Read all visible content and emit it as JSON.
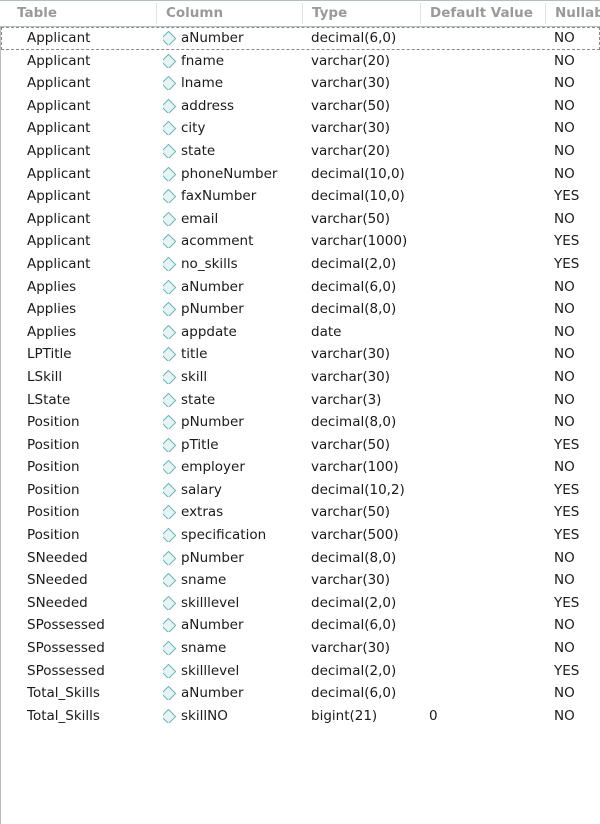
{
  "grid": {
    "columns": [
      {
        "key": "table",
        "label": "Table"
      },
      {
        "key": "column",
        "label": "Column"
      },
      {
        "key": "type",
        "label": "Type"
      },
      {
        "key": "default",
        "label": "Default Value"
      },
      {
        "key": "nullable",
        "label": "Nullab"
      }
    ],
    "column_icon_name": "column-key-diamond-icon",
    "focused_row_index": 0,
    "accent_icon_color": "#68b4b8",
    "header_text_color": "#9a9a9a",
    "border_color": "#b4bcc6",
    "rows": [
      {
        "table": "Applicant",
        "column": "aNumber",
        "type": "decimal(6,0)",
        "default": "",
        "nullable": "NO"
      },
      {
        "table": "Applicant",
        "column": "fname",
        "type": "varchar(20)",
        "default": "",
        "nullable": "NO"
      },
      {
        "table": "Applicant",
        "column": "lname",
        "type": "varchar(30)",
        "default": "",
        "nullable": "NO"
      },
      {
        "table": "Applicant",
        "column": "address",
        "type": "varchar(50)",
        "default": "",
        "nullable": "NO"
      },
      {
        "table": "Applicant",
        "column": "city",
        "type": "varchar(30)",
        "default": "",
        "nullable": "NO"
      },
      {
        "table": "Applicant",
        "column": "state",
        "type": "varchar(20)",
        "default": "",
        "nullable": "NO"
      },
      {
        "table": "Applicant",
        "column": "phoneNumber",
        "type": "decimal(10,0)",
        "default": "",
        "nullable": "NO"
      },
      {
        "table": "Applicant",
        "column": "faxNumber",
        "type": "decimal(10,0)",
        "default": "",
        "nullable": "YES"
      },
      {
        "table": "Applicant",
        "column": "email",
        "type": "varchar(50)",
        "default": "",
        "nullable": "NO"
      },
      {
        "table": "Applicant",
        "column": "acomment",
        "type": "varchar(1000)",
        "default": "",
        "nullable": "YES"
      },
      {
        "table": "Applicant",
        "column": "no_skills",
        "type": "decimal(2,0)",
        "default": "",
        "nullable": "YES"
      },
      {
        "table": "Applies",
        "column": "aNumber",
        "type": "decimal(6,0)",
        "default": "",
        "nullable": "NO"
      },
      {
        "table": "Applies",
        "column": "pNumber",
        "type": "decimal(8,0)",
        "default": "",
        "nullable": "NO"
      },
      {
        "table": "Applies",
        "column": "appdate",
        "type": "date",
        "default": "",
        "nullable": "NO"
      },
      {
        "table": "LPTitle",
        "column": "title",
        "type": "varchar(30)",
        "default": "",
        "nullable": "NO"
      },
      {
        "table": "LSkill",
        "column": "skill",
        "type": "varchar(30)",
        "default": "",
        "nullable": "NO"
      },
      {
        "table": "LState",
        "column": "state",
        "type": "varchar(3)",
        "default": "",
        "nullable": "NO"
      },
      {
        "table": "Position",
        "column": "pNumber",
        "type": "decimal(8,0)",
        "default": "",
        "nullable": "NO"
      },
      {
        "table": "Position",
        "column": "pTitle",
        "type": "varchar(50)",
        "default": "",
        "nullable": "YES"
      },
      {
        "table": "Position",
        "column": "employer",
        "type": "varchar(100)",
        "default": "",
        "nullable": "NO"
      },
      {
        "table": "Position",
        "column": "salary",
        "type": "decimal(10,2)",
        "default": "",
        "nullable": "YES"
      },
      {
        "table": "Position",
        "column": "extras",
        "type": "varchar(50)",
        "default": "",
        "nullable": "YES"
      },
      {
        "table": "Position",
        "column": "specification",
        "type": "varchar(500)",
        "default": "",
        "nullable": "YES"
      },
      {
        "table": "SNeeded",
        "column": "pNumber",
        "type": "decimal(8,0)",
        "default": "",
        "nullable": "NO"
      },
      {
        "table": "SNeeded",
        "column": "sname",
        "type": "varchar(30)",
        "default": "",
        "nullable": "NO"
      },
      {
        "table": "SNeeded",
        "column": "skilllevel",
        "type": "decimal(2,0)",
        "default": "",
        "nullable": "YES"
      },
      {
        "table": "SPossessed",
        "column": "aNumber",
        "type": "decimal(6,0)",
        "default": "",
        "nullable": "NO"
      },
      {
        "table": "SPossessed",
        "column": "sname",
        "type": "varchar(30)",
        "default": "",
        "nullable": "NO"
      },
      {
        "table": "SPossessed",
        "column": "skilllevel",
        "type": "decimal(2,0)",
        "default": "",
        "nullable": "YES"
      },
      {
        "table": "Total_Skills",
        "column": "aNumber",
        "type": "decimal(6,0)",
        "default": "",
        "nullable": "NO"
      },
      {
        "table": "Total_Skills",
        "column": "skillNO",
        "type": "bigint(21)",
        "default": "0",
        "nullable": "NO"
      }
    ]
  }
}
